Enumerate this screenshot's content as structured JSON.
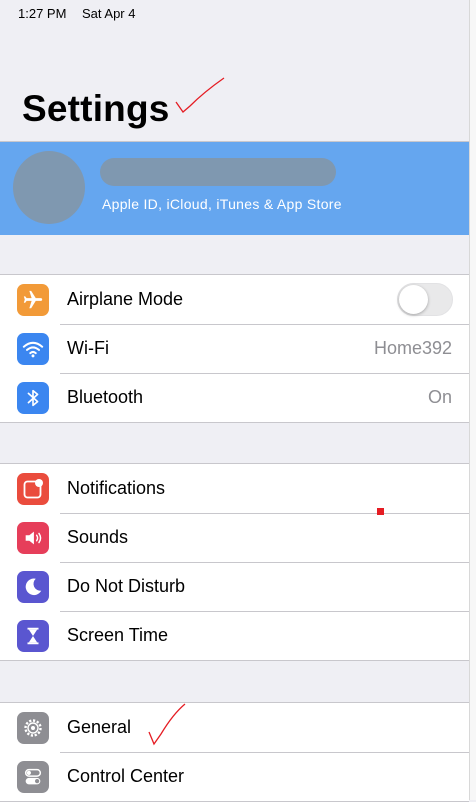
{
  "status_bar": {
    "time": "1:27 PM",
    "date": "Sat Apr 4"
  },
  "header": {
    "title": "Settings"
  },
  "account": {
    "subtitle": "Apple ID, iCloud, iTunes & App Store"
  },
  "groups": [
    {
      "items": [
        {
          "label": "Airplane Mode",
          "icon": "airplane-icon",
          "icon_color": "#f29a38",
          "control": "toggle",
          "toggle_on": false
        },
        {
          "label": "Wi-Fi",
          "icon": "wifi-icon",
          "icon_color": "#3b86f0",
          "value": "Home392"
        },
        {
          "label": "Bluetooth",
          "icon": "bluetooth-icon",
          "icon_color": "#3b86f0",
          "value": "On"
        }
      ]
    },
    {
      "items": [
        {
          "label": "Notifications",
          "icon": "notifications-icon",
          "icon_color": "#ea4c3d"
        },
        {
          "label": "Sounds",
          "icon": "speaker-icon",
          "icon_color": "#e63e5a"
        },
        {
          "label": "Do Not Disturb",
          "icon": "moon-icon",
          "icon_color": "#5a56d0"
        },
        {
          "label": "Screen Time",
          "icon": "hourglass-icon",
          "icon_color": "#5a56d0"
        }
      ]
    },
    {
      "items": [
        {
          "label": "General",
          "icon": "gear-icon",
          "icon_color": "#8e8e93"
        },
        {
          "label": "Control Center",
          "icon": "toggles-icon",
          "icon_color": "#8e8e93"
        }
      ]
    }
  ],
  "colors": {
    "banner": "#65a6ef",
    "redaction": "#7f98b0",
    "annotation_red": "#e51c23"
  }
}
